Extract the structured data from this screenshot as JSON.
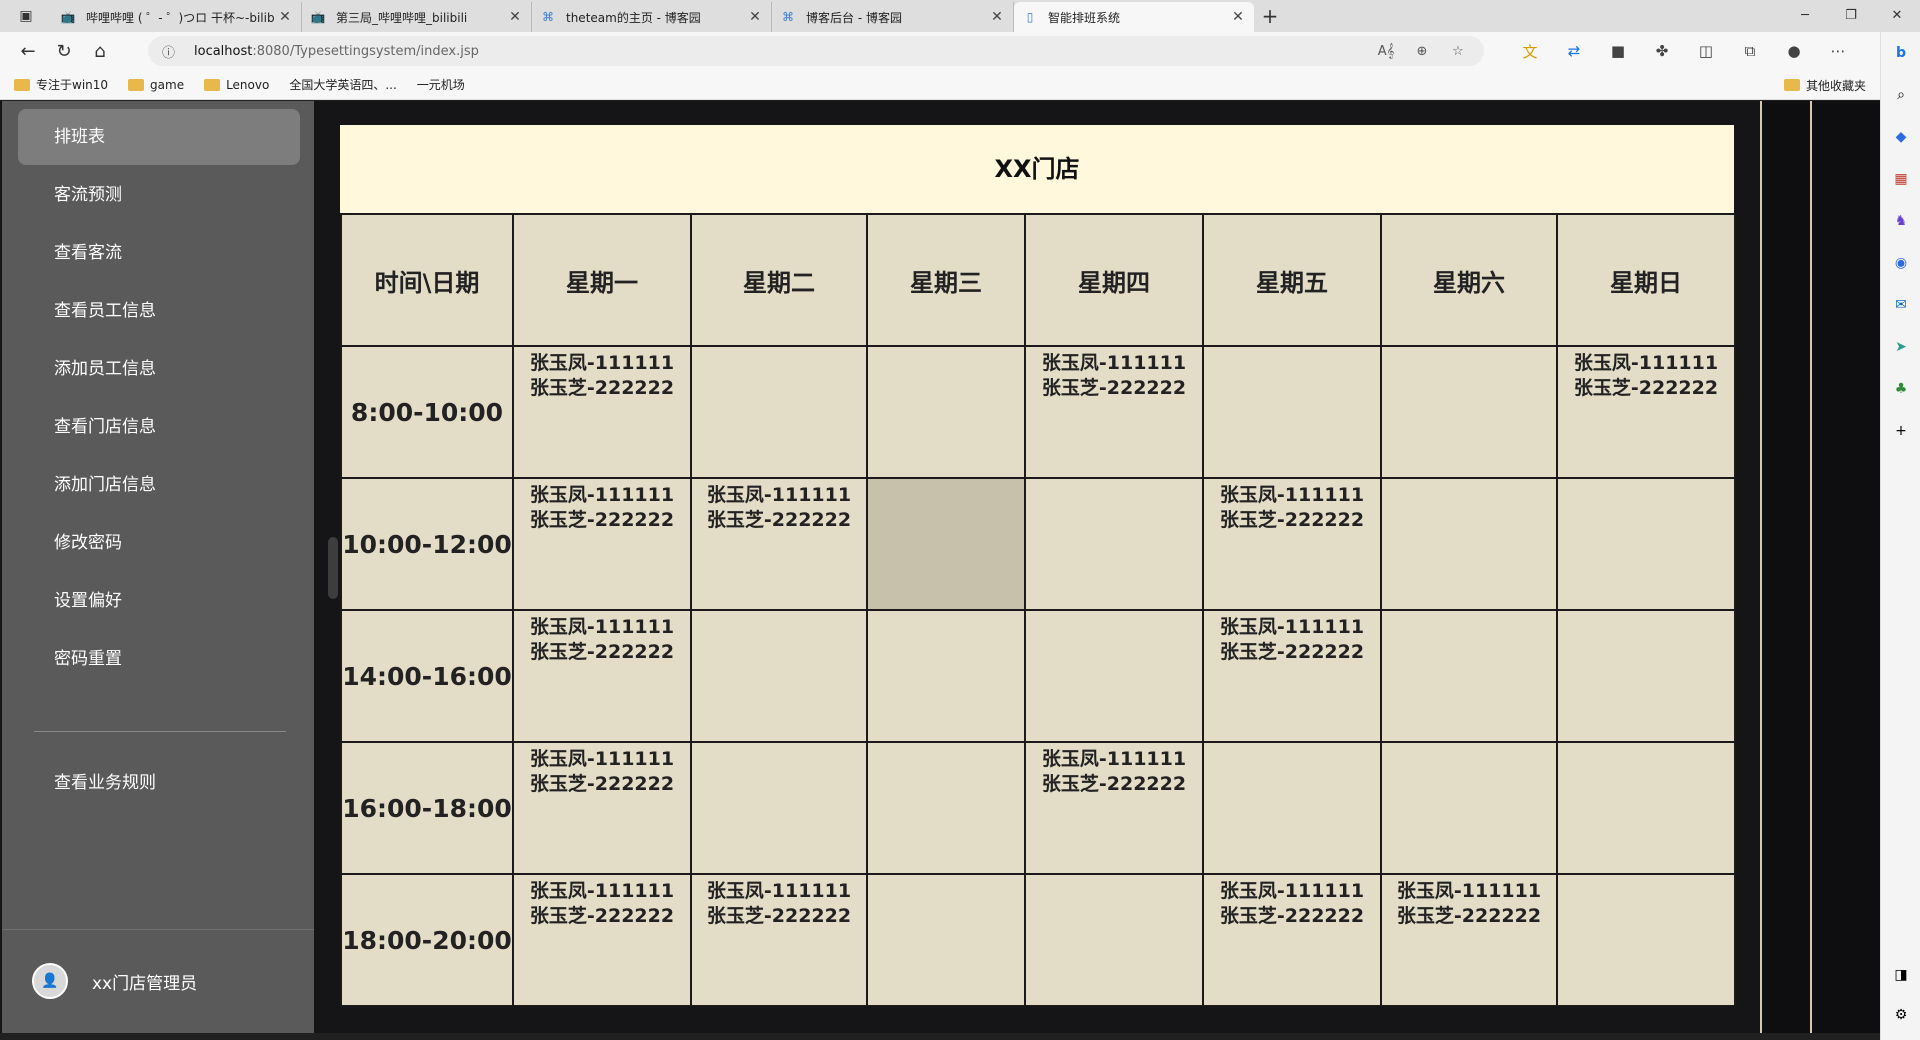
{
  "browser": {
    "tabs": [
      {
        "title": "哔哩哔哩 ( ゜- ゜)つロ 干杯~-bilib",
        "icon": "bilibili-icon",
        "active": false
      },
      {
        "title": "第三局_哔哩哔哩_bilibili",
        "icon": "bilibili-icon",
        "active": false
      },
      {
        "title": "theteam的主页 - 博客园",
        "icon": "cnblogs-icon",
        "active": false
      },
      {
        "title": "博客后台 - 博客园",
        "icon": "cnblogs-icon",
        "active": false
      },
      {
        "title": "智能排班系统",
        "icon": "page-icon",
        "active": true
      }
    ],
    "url_host": "localhost",
    "url_path": ":8080/Typesettingsystem/index.jsp",
    "bookmarks": [
      {
        "label": "专注于win10",
        "type": "folder"
      },
      {
        "label": "game",
        "type": "folder"
      },
      {
        "label": "Lenovo",
        "type": "folder"
      },
      {
        "label": "全国大学英语四、...",
        "type": "page"
      },
      {
        "label": "一元机场",
        "type": "page"
      }
    ],
    "other_bookmarks": "其他收藏夹"
  },
  "sidebar": {
    "items": [
      {
        "label": "排班表",
        "active": true
      },
      {
        "label": "客流预测"
      },
      {
        "label": "查看客流"
      },
      {
        "label": "查看员工信息"
      },
      {
        "label": "添加员工信息"
      },
      {
        "label": "查看门店信息"
      },
      {
        "label": "添加门店信息"
      },
      {
        "label": "修改密码"
      },
      {
        "label": "设置偏好"
      },
      {
        "label": "密码重置"
      }
    ],
    "extra_item": "查看业务规则",
    "admin_name": "xx门店管理员"
  },
  "schedule": {
    "store_name": "XX门店",
    "corner_header": "时间\\日期",
    "days": [
      "星期一",
      "星期二",
      "星期三",
      "星期四",
      "星期五",
      "星期六",
      "星期日"
    ],
    "rows": [
      {
        "time": "8:00-10:00",
        "cells": [
          [
            "张玉凤-111111",
            "张玉芝-222222"
          ],
          [],
          [],
          [
            "张玉凤-111111",
            "张玉芝-222222"
          ],
          [],
          [],
          [
            "张玉凤-111111",
            "张玉芝-222222"
          ]
        ]
      },
      {
        "time": "10:00-12:00",
        "cells": [
          [
            "张玉凤-111111",
            "张玉芝-222222"
          ],
          [
            "张玉凤-111111",
            "张玉芝-222222"
          ],
          [],
          [],
          [
            "张玉凤-111111",
            "张玉芝-222222"
          ],
          [],
          []
        ]
      },
      {
        "time": "14:00-16:00",
        "cells": [
          [
            "张玉凤-111111",
            "张玉芝-222222"
          ],
          [],
          [],
          [],
          [
            "张玉凤-111111",
            "张玉芝-222222"
          ],
          [],
          []
        ]
      },
      {
        "time": "16:00-18:00",
        "cells": [
          [
            "张玉凤-111111",
            "张玉芝-222222"
          ],
          [],
          [],
          [
            "张玉凤-111111",
            "张玉芝-222222"
          ],
          [],
          [],
          []
        ]
      },
      {
        "time": "18:00-20:00",
        "cells": [
          [
            "张玉凤-111111",
            "张玉芝-222222"
          ],
          [
            "张玉凤-111111",
            "张玉芝-222222"
          ],
          [],
          [],
          [
            "张玉凤-111111",
            "张玉芝-222222"
          ],
          [
            "张玉凤-111111",
            "张玉芝-222222"
          ],
          []
        ]
      }
    ]
  },
  "colors": {
    "sidebar_bg": "#5a5a5a",
    "title_bg": "#fff8dd",
    "cell_bg": "#e3ddc8",
    "highlight_cell": "#c7c1ac"
  }
}
